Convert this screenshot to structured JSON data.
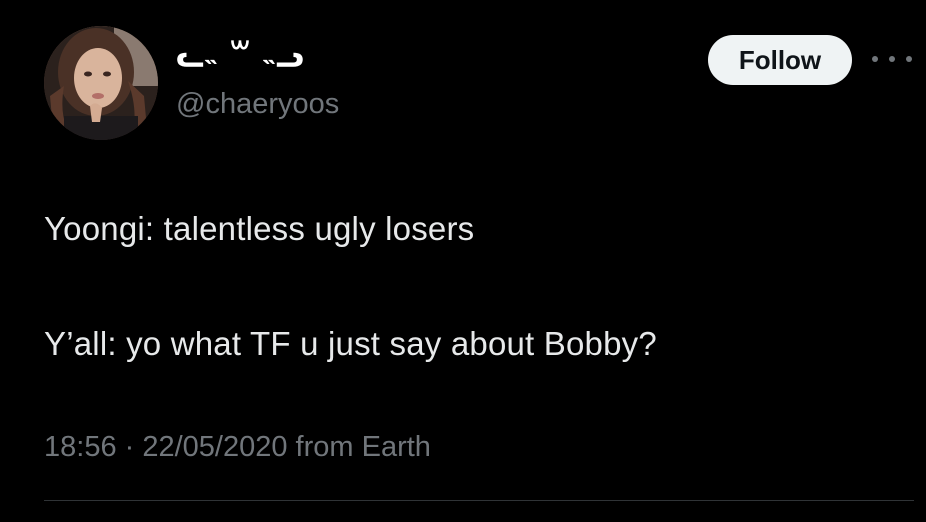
{
  "tweet": {
    "display_name": "ᓚ˵ ꒳ ˵ᓗ",
    "handle": "@chaeryoos",
    "follow_label": "Follow",
    "more_icon": "ellipsis-icon",
    "body_line_1": "Yoongi: talentless ugly losers",
    "body_line_2": "Y’all: yo what TF u just say about Bobby?",
    "timestamp": "18:56 · 22/05/2020 from Earth"
  },
  "colors": {
    "background": "#000000",
    "text_primary": "#e7e9ea",
    "text_secondary": "#71767b",
    "follow_button_bg": "#eff3f4",
    "divider": "#2f3336"
  }
}
